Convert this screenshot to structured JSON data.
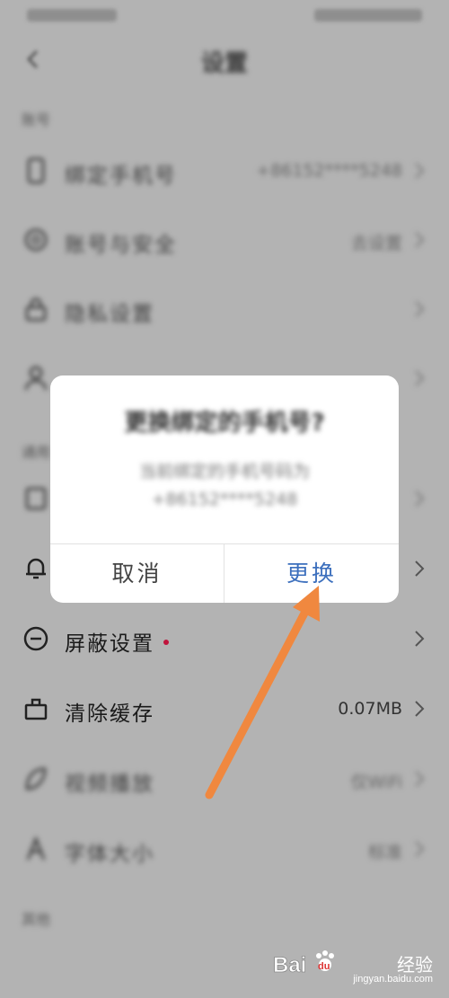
{
  "page": {
    "title": "设置"
  },
  "sections": {
    "account": "账号",
    "general": "通用",
    "other": "其他"
  },
  "rows": {
    "phone": {
      "label": "绑定手机号",
      "value": "+86152****5248"
    },
    "security": {
      "label": "账号与安全",
      "value": "去设置"
    },
    "privacy": {
      "label": "隐私设置"
    },
    "blocked": {
      "label": "屏蔽设置"
    },
    "clear_cache": {
      "label": "清除缓存",
      "value": "0.07MB"
    },
    "play_mode": {
      "label": "视频播放",
      "value": "仅WiFi"
    },
    "font_size": {
      "label": "字体大小",
      "value": "标准"
    }
  },
  "dialog": {
    "title": "更换绑定的手机号?",
    "message_line1": "当前绑定的手机号码为",
    "message_line2": "+86152****5248",
    "cancel_label": "取消",
    "confirm_label": "更换"
  },
  "watermark": {
    "text": "经验",
    "url": "jingyan.baidu.com"
  },
  "colors": {
    "overlay": "#b3b3b3",
    "accent": "#3c6fbd",
    "dot": "#c0143c",
    "arrow": "#f0883f"
  }
}
